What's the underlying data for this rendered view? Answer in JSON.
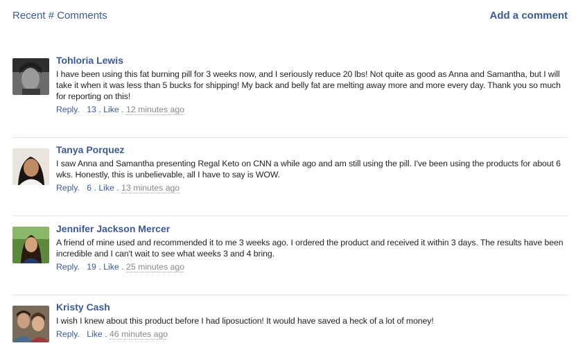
{
  "header": {
    "title": "Recent # Comments",
    "add_comment": "Add a comment"
  },
  "comments": [
    {
      "name": "Tohloria Lewis",
      "text": "I have been using this fat burning pill for 3 weeks now, and I seriously reduce 20 lbs! Not quite as good as Anna and Samantha, but I will take it when it was less than 5 bucks for shipping! My back and belly fat are melting away more and more every day. Thank you so much for reporting on this!",
      "reply": "Reply.",
      "likes": "13",
      "like": "Like",
      "time": "12 minutes ago"
    },
    {
      "name": "Tanya Porquez",
      "text": "I saw Anna and Samantha presenting Regal Keto on CNN a while ago and am still using the pill. I've been using the products for about 6 wks. Honestly, this is unbelievable, all I have to say is WOW.",
      "reply": "Reply.",
      "likes": "6",
      "like": "Like",
      "time": "13 minutes ago"
    },
    {
      "name": "Jennifer Jackson Mercer",
      "text": "A friend of mine used and recommended it to me 3 weeks ago. I ordered the product and received it within 3 days. The results have been incredible and I can't wait to see what weeks 3 and 4 bring.",
      "reply": "Reply.",
      "likes": "19",
      "like": "Like",
      "time": "25 minutes ago"
    },
    {
      "name": "Kristy Cash",
      "text": "I wish I knew about this product before I had liposuction! It would have saved a heck of a lot of money!",
      "reply": "Reply.",
      "likes": "",
      "like": "Like",
      "time": "46 minutes ago"
    }
  ]
}
